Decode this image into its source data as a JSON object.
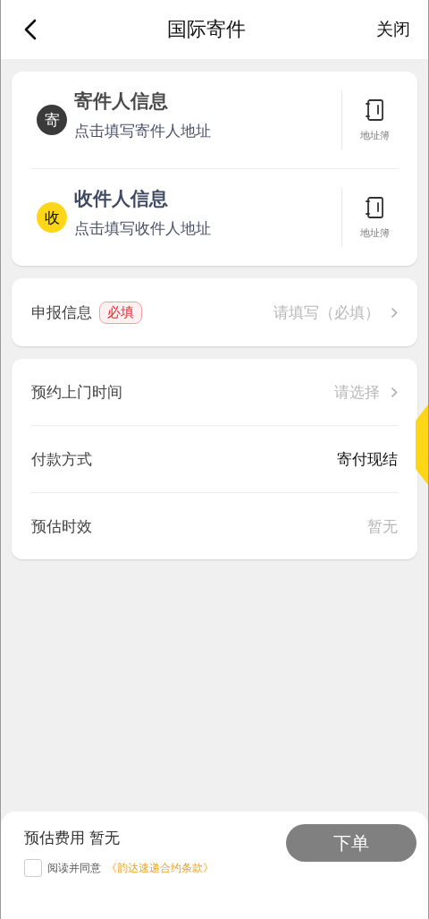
{
  "header": {
    "title": "国际寄件",
    "close": "关闭"
  },
  "contacts": [
    {
      "kind": "sender",
      "badge": "寄",
      "title": "寄件人信息",
      "hint": "点击填写寄件人地址",
      "book": "地址簿"
    },
    {
      "kind": "receiver",
      "badge": "收",
      "title": "收件人信息",
      "hint": "点击填写收件人地址",
      "book": "地址簿"
    }
  ],
  "declaration": {
    "label": "申报信息",
    "tag": "必填",
    "placeholder": "请填写（必填）"
  },
  "details": [
    {
      "kind": "select",
      "label": "预约上门时间",
      "value": "请选择"
    },
    {
      "kind": "fixed",
      "label": "付款方式",
      "value": "寄付现结"
    },
    {
      "kind": "info",
      "label": "预估时效",
      "value": "暂无"
    }
  ],
  "footer": {
    "fee_label": "预估费用",
    "fee": "暂无",
    "agree_checked": false,
    "agree_text": "阅读并同意",
    "terms_link": "《韵达速递合约条款》",
    "submit": "下单",
    "submit_disabled": true
  }
}
